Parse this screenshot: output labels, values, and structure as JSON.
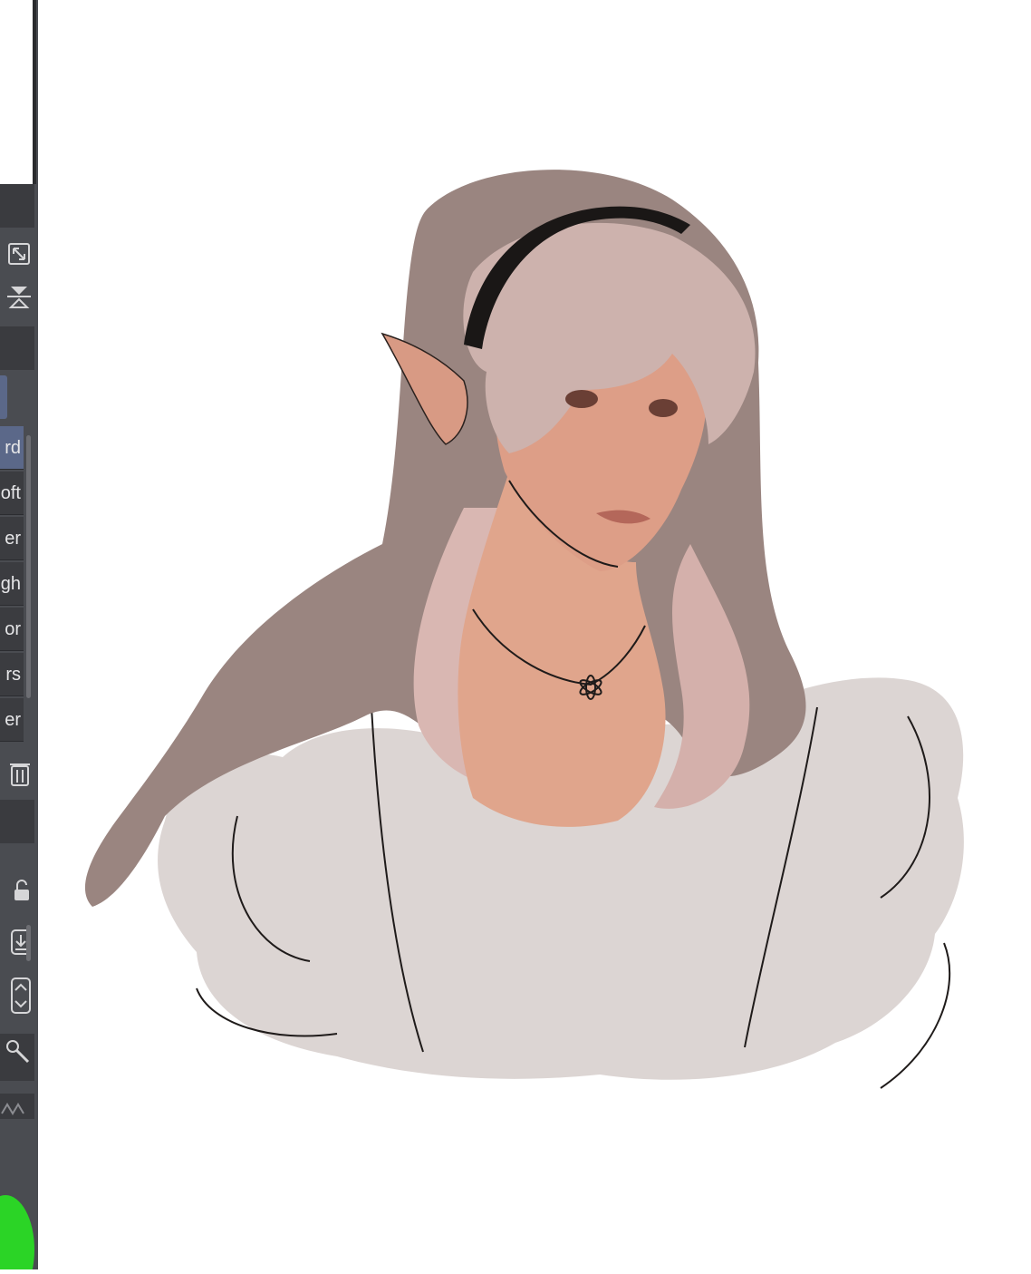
{
  "sidebar": {
    "brush_list": [
      {
        "label": "rd",
        "selected": true
      },
      {
        "label": "oft",
        "selected": false
      },
      {
        "label": "er",
        "selected": false
      },
      {
        "label": "gh",
        "selected": false
      },
      {
        "label": "or",
        "selected": false
      },
      {
        "label": "rs",
        "selected": false
      },
      {
        "label": "er",
        "selected": false
      }
    ]
  },
  "colors": {
    "panel": "#4a4c51",
    "selected": "#5b6889",
    "accent_green": "#2bd426"
  },
  "icons": [
    "resize-icon",
    "flip-vertical-icon",
    "trash-icon",
    "lock-icon",
    "download-icon",
    "up-down-icon",
    "wrench-icon",
    "gradient-icon"
  ]
}
